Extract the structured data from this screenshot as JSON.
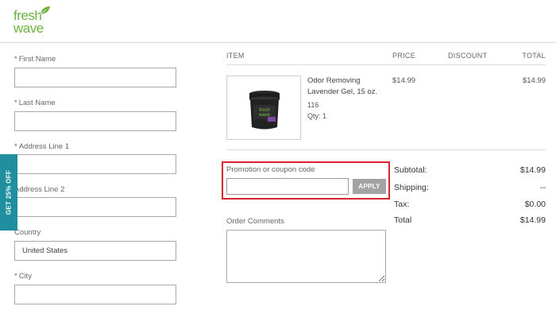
{
  "brand": {
    "line1": "fresh",
    "line2": "wave",
    "color": "#6cb33f"
  },
  "side_tab": {
    "label": "GET 25% OFF",
    "color": "#1f8e9e"
  },
  "form": {
    "first_name": {
      "label": "First Name",
      "required_mark": "*",
      "value": ""
    },
    "last_name": {
      "label": "Last Name",
      "required_mark": "*",
      "value": ""
    },
    "address1": {
      "label": "Address Line 1",
      "required_mark": "*",
      "value": ""
    },
    "address2": {
      "label": "Address Line 2",
      "value": ""
    },
    "country": {
      "label": "Country",
      "value": "United States"
    },
    "city": {
      "label": "City",
      "required_mark": "*",
      "value": ""
    }
  },
  "cart": {
    "headers": {
      "item": "ITEM",
      "price": "PRICE",
      "discount": "DISCOUNT",
      "total": "TOTAL"
    },
    "items": [
      {
        "name": "Odor Removing Lavender Gel, 15 oz.",
        "sku": "116",
        "qty": "Qty: 1",
        "price": "$14.99",
        "total": "$14.99",
        "image_icon": "lavender-gel-jar"
      }
    ]
  },
  "promo": {
    "label": "Promotion or coupon code",
    "value": "",
    "apply_label": "APPLY",
    "highlight_color": "#d9232e"
  },
  "summary": {
    "subtotal_label": "Subtotal:",
    "subtotal": "$14.99",
    "shipping_label": "Shipping:",
    "shipping": "--",
    "tax_label": "Tax:",
    "tax": "$0.00",
    "total_label": "Total",
    "total": "$14.99"
  },
  "comments": {
    "label": "Order Comments",
    "value": ""
  }
}
